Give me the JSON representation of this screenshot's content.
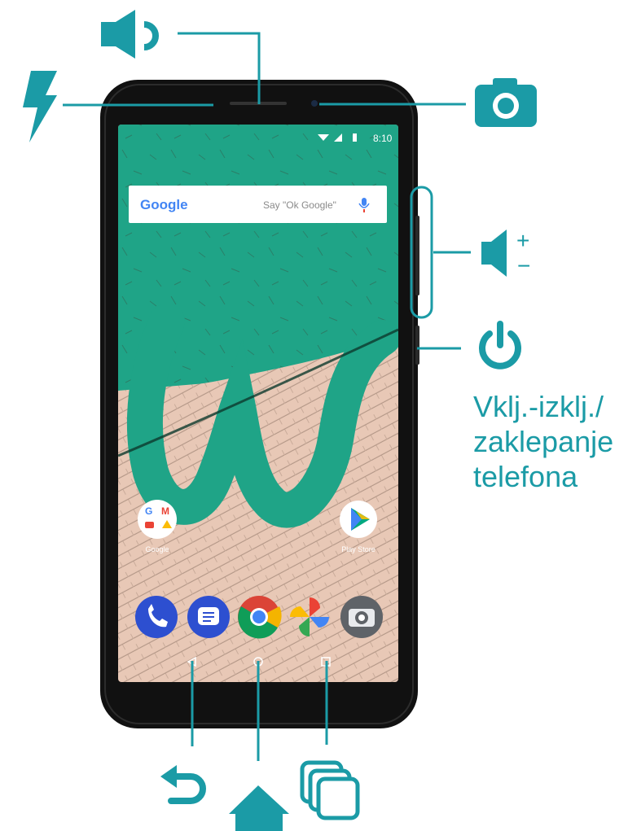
{
  "colors": {
    "accent": "#1b9ba6",
    "phone_body": "#111111",
    "wallpaper_green": "#1fa487",
    "wallpaper_tile": "#e8c8b6"
  },
  "status_bar": {
    "time": "8:10"
  },
  "search_widget": {
    "brand": "Google",
    "hint": "Say \"Ok Google\"",
    "mic_icon": "mic-icon"
  },
  "home_screen": {
    "folder_label": "Google",
    "play_store_label": "Play Store",
    "dock_icons": [
      "phone-icon",
      "messages-icon",
      "chrome-icon",
      "photos-icon",
      "camera-app-icon"
    ]
  },
  "callouts": {
    "speaker": "speaker-icon",
    "flash": "flash-icon",
    "front_camera": "camera-icon",
    "volume": "volume-icon",
    "volume_plus": "+",
    "volume_minus": "−",
    "power": "power-icon",
    "power_label": "Vklj.-izklj./\nzaklepanje\ntelefona",
    "back": "back-icon",
    "home": "home-icon",
    "recents": "recents-icon"
  }
}
